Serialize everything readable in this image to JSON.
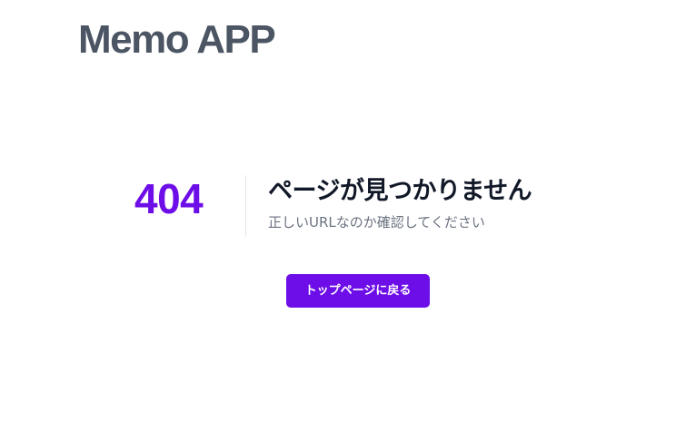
{
  "header": {
    "app_title": "Memo APP"
  },
  "error": {
    "code": "404",
    "heading": "ページが見つかりません",
    "message": "正しいURLなのか確認してください"
  },
  "actions": {
    "home_button_label": "トップページに戻る"
  },
  "colors": {
    "brand_accent": "#6d0ee8",
    "title_text": "#4b5563",
    "heading_text": "#111827",
    "muted_text": "#6b7280",
    "divider": "#e5e7eb"
  }
}
